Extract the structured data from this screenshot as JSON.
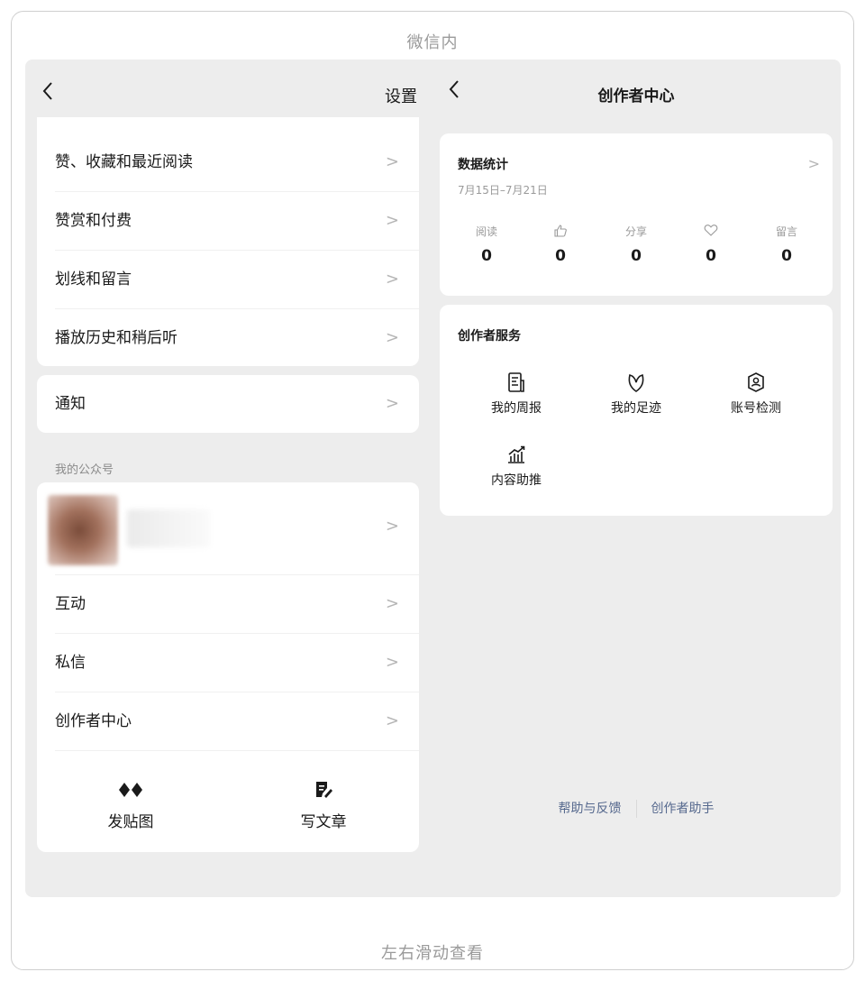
{
  "caption_top": "微信内",
  "caption_bottom": "左右滑动查看",
  "left": {
    "title": "设置",
    "menu": [
      {
        "label": "赞、收藏和最近阅读"
      },
      {
        "label": "赞赏和付费"
      },
      {
        "label": "划线和留言"
      },
      {
        "label": "播放历史和稍后听"
      }
    ],
    "notify": {
      "label": "通知"
    },
    "section_label": "我的公众号",
    "account_rows": [
      {
        "label": "互动"
      },
      {
        "label": "私信"
      },
      {
        "label": "创作者中心"
      }
    ],
    "tools": {
      "post_image": "发贴图",
      "write_article": "写文章"
    },
    "chevron": ">"
  },
  "right": {
    "title": "创作者中心",
    "stats": {
      "title": "数据统计",
      "range": "7月15日–7月21日",
      "metrics": [
        {
          "label": "阅读",
          "icon": "",
          "value": "0"
        },
        {
          "label": "",
          "icon": "thumbs-up-icon",
          "value": "0"
        },
        {
          "label": "分享",
          "icon": "",
          "value": "0"
        },
        {
          "label": "",
          "icon": "heart-icon",
          "value": "0"
        },
        {
          "label": "留言",
          "icon": "",
          "value": "0"
        }
      ]
    },
    "services": {
      "title": "创作者服务",
      "items": [
        {
          "label": "我的周报",
          "icon": "report-icon"
        },
        {
          "label": "我的足迹",
          "icon": "sprout-icon"
        },
        {
          "label": "账号检测",
          "icon": "account-check-icon"
        },
        {
          "label": "内容助推",
          "icon": "boost-chart-icon"
        }
      ]
    },
    "footer": {
      "help": "帮助与反馈",
      "assistant": "创作者助手"
    }
  },
  "colors": {
    "stage_bg": "#ededed",
    "card_bg": "#ffffff",
    "link": "#56698e",
    "muted": "#9a9a9a"
  }
}
